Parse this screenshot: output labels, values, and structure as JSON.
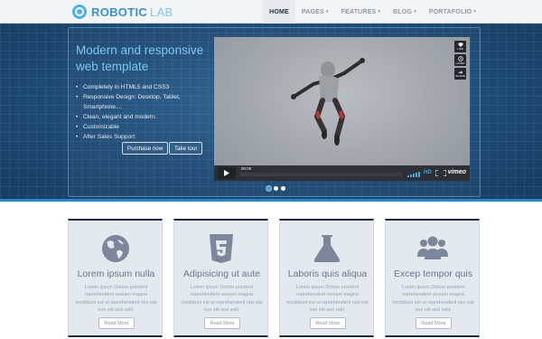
{
  "brand": {
    "name_strong": "ROBOTIC",
    "name_light": "LAB"
  },
  "nav": [
    {
      "label": "HOME",
      "active": true,
      "has_menu": false
    },
    {
      "label": "PAGES",
      "active": false,
      "has_menu": true
    },
    {
      "label": "FEATURES",
      "active": false,
      "has_menu": true
    },
    {
      "label": "BLOG",
      "active": false,
      "has_menu": true
    },
    {
      "label": "PORTAFOLIO",
      "active": false,
      "has_menu": true
    }
  ],
  "nav_caret": "▾",
  "hero": {
    "title": "Modern and responsive web template",
    "features": [
      "Completely in HTML5 and CSS3",
      "Responsive Design: Desktop, Tablet, Smartphone....",
      "Clean, elegant and modern.",
      "Customizable",
      "After Sales Support"
    ],
    "buttons": {
      "purchase": "Purchase now",
      "tour": "Take tour"
    },
    "video": {
      "side_buttons": [
        "LIKE",
        "LATER",
        "SHARE"
      ],
      "time": "00:00",
      "hd_label": "HD",
      "provider": "vimeo",
      "progress": 0
    },
    "slider_dots": 3,
    "active_dot": 0
  },
  "cards": [
    {
      "icon": "globe-icon",
      "title": "Lorem ipsum nulla",
      "text": "Lorem ipsum Dolore proident reprehenderit veniam magna incididunt est ut reprehenderit nisi nisi non elit sed velit.",
      "button": "Read More"
    },
    {
      "icon": "html5-icon",
      "title": "Adipisicing ut aute",
      "text": "Lorem ipsum Dolore proident reprehenderit veniam magna incididunt est ut reprehenderit nisi nisi non elit sed velit.",
      "button": "Read More"
    },
    {
      "icon": "flask-icon",
      "title": "Laboris quis aliqua",
      "text": "Lorem ipsum Dolore proident reprehenderit veniam magna incididunt est ut reprehenderit nisi nisi non elit sed velit.",
      "button": "Read More"
    },
    {
      "icon": "users-icon",
      "title": "Excep tempor quis",
      "text": "Lorem ipsum Dolore proident reprehenderit veniam magna incididunt est ut reprehenderit nisi nisi non elit sed velit.",
      "button": "Read More"
    }
  ],
  "colors": {
    "accent": "#3a8fd0",
    "hero_bg": "#1c4670",
    "card_bg": "#e4e8ef",
    "card_border": "#1b2a4a",
    "hero_title": "#79c6f0"
  }
}
